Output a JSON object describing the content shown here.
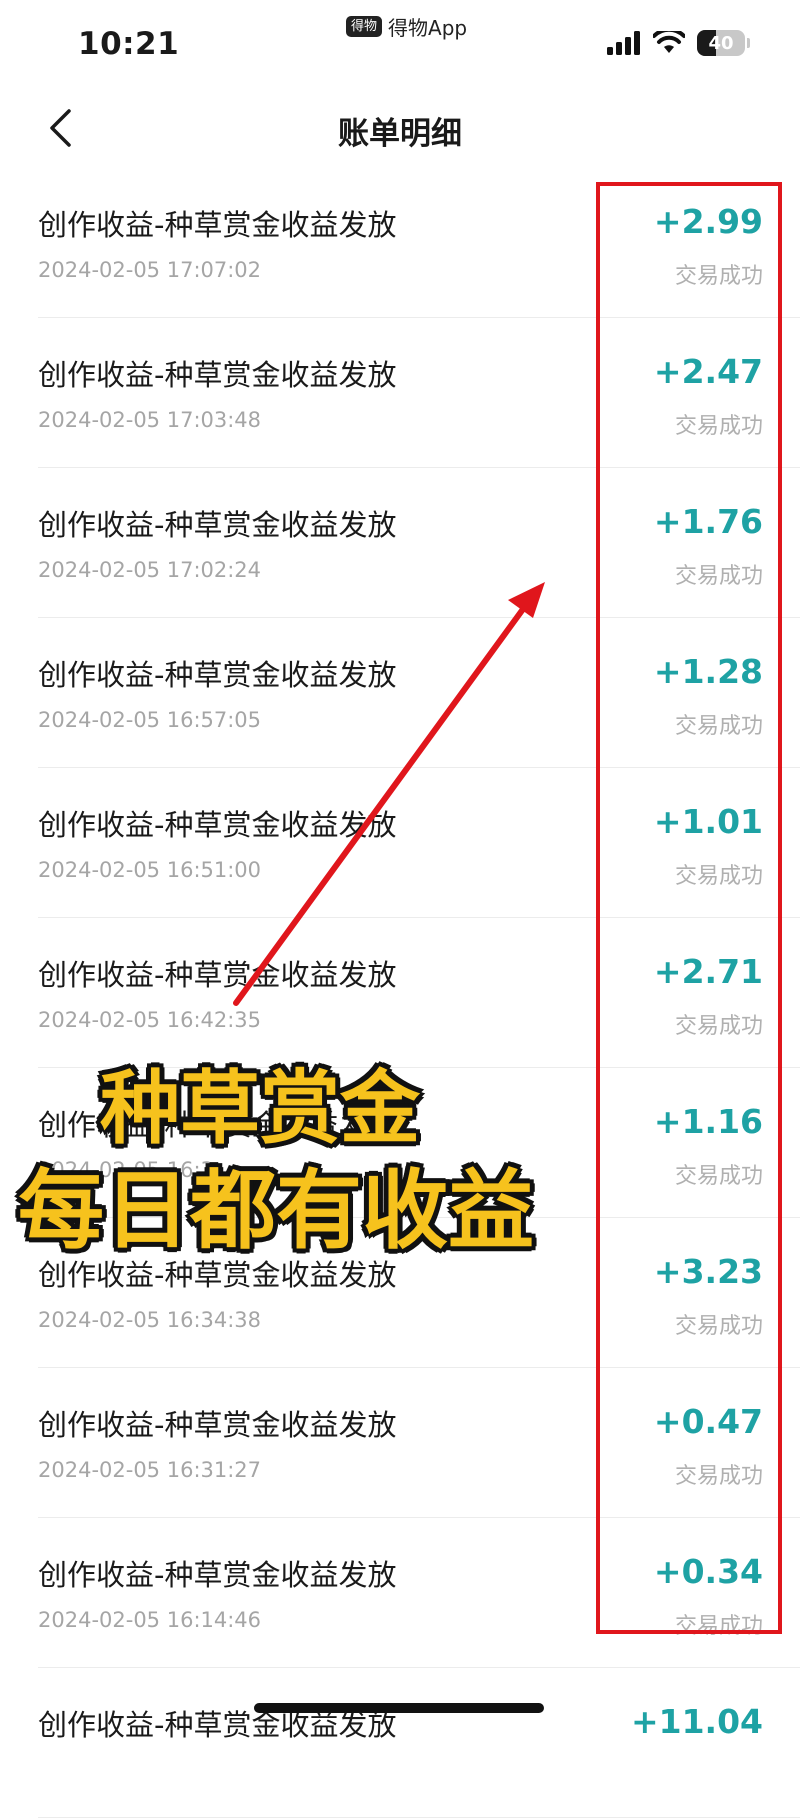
{
  "status_bar": {
    "time": "10:21",
    "app_name": "得物App",
    "app_badge": "得物",
    "battery": "40",
    "battery_level_percent": 40
  },
  "nav": {
    "title": "账单明细"
  },
  "rows": [
    {
      "title": "创作收益-种草赏金收益发放",
      "time": "2024-02-05 17:07:02",
      "amount": "+2.99",
      "status": "交易成功"
    },
    {
      "title": "创作收益-种草赏金收益发放",
      "time": "2024-02-05 17:03:48",
      "amount": "+2.47",
      "status": "交易成功"
    },
    {
      "title": "创作收益-种草赏金收益发放",
      "time": "2024-02-05 17:02:24",
      "amount": "+1.76",
      "status": "交易成功"
    },
    {
      "title": "创作收益-种草赏金收益发放",
      "time": "2024-02-05 16:57:05",
      "amount": "+1.28",
      "status": "交易成功"
    },
    {
      "title": "创作收益-种草赏金收益发放",
      "time": "2024-02-05 16:51:00",
      "amount": "+1.01",
      "status": "交易成功"
    },
    {
      "title": "创作收益-种草赏金收益发放",
      "time": "2024-02-05 16:42:35",
      "amount": "+2.71",
      "status": "交易成功"
    },
    {
      "title": "创作收益-种草赏金收益发放",
      "time": "2024-02-05 16:3",
      "amount": "+1.16",
      "status": "交易成功"
    },
    {
      "title": "创作收益-种草赏金收益发放",
      "time": "2024-02-05 16:34:38",
      "amount": "+3.23",
      "status": "交易成功"
    },
    {
      "title": "创作收益-种草赏金收益发放",
      "time": "2024-02-05 16:31:27",
      "amount": "+0.47",
      "status": "交易成功"
    },
    {
      "title": "创作收益-种草赏金收益发放",
      "time": "2024-02-05 16:14:46",
      "amount": "+0.34",
      "status": "交易成功"
    },
    {
      "title": "创作收益-种草赏金收益发放",
      "time": "",
      "amount": "+11.04",
      "status": ""
    }
  ],
  "overlay": {
    "line1": "种草赏金",
    "line2": "每日都有收益"
  },
  "colors": {
    "amount": "#1ea2a4",
    "annotation": "#e0161c",
    "overlay_text": "#f6c21d"
  },
  "icons": {
    "back": "chevron-left-icon",
    "signal": "signal-icon",
    "wifi": "wifi-icon",
    "battery": "battery-icon"
  }
}
